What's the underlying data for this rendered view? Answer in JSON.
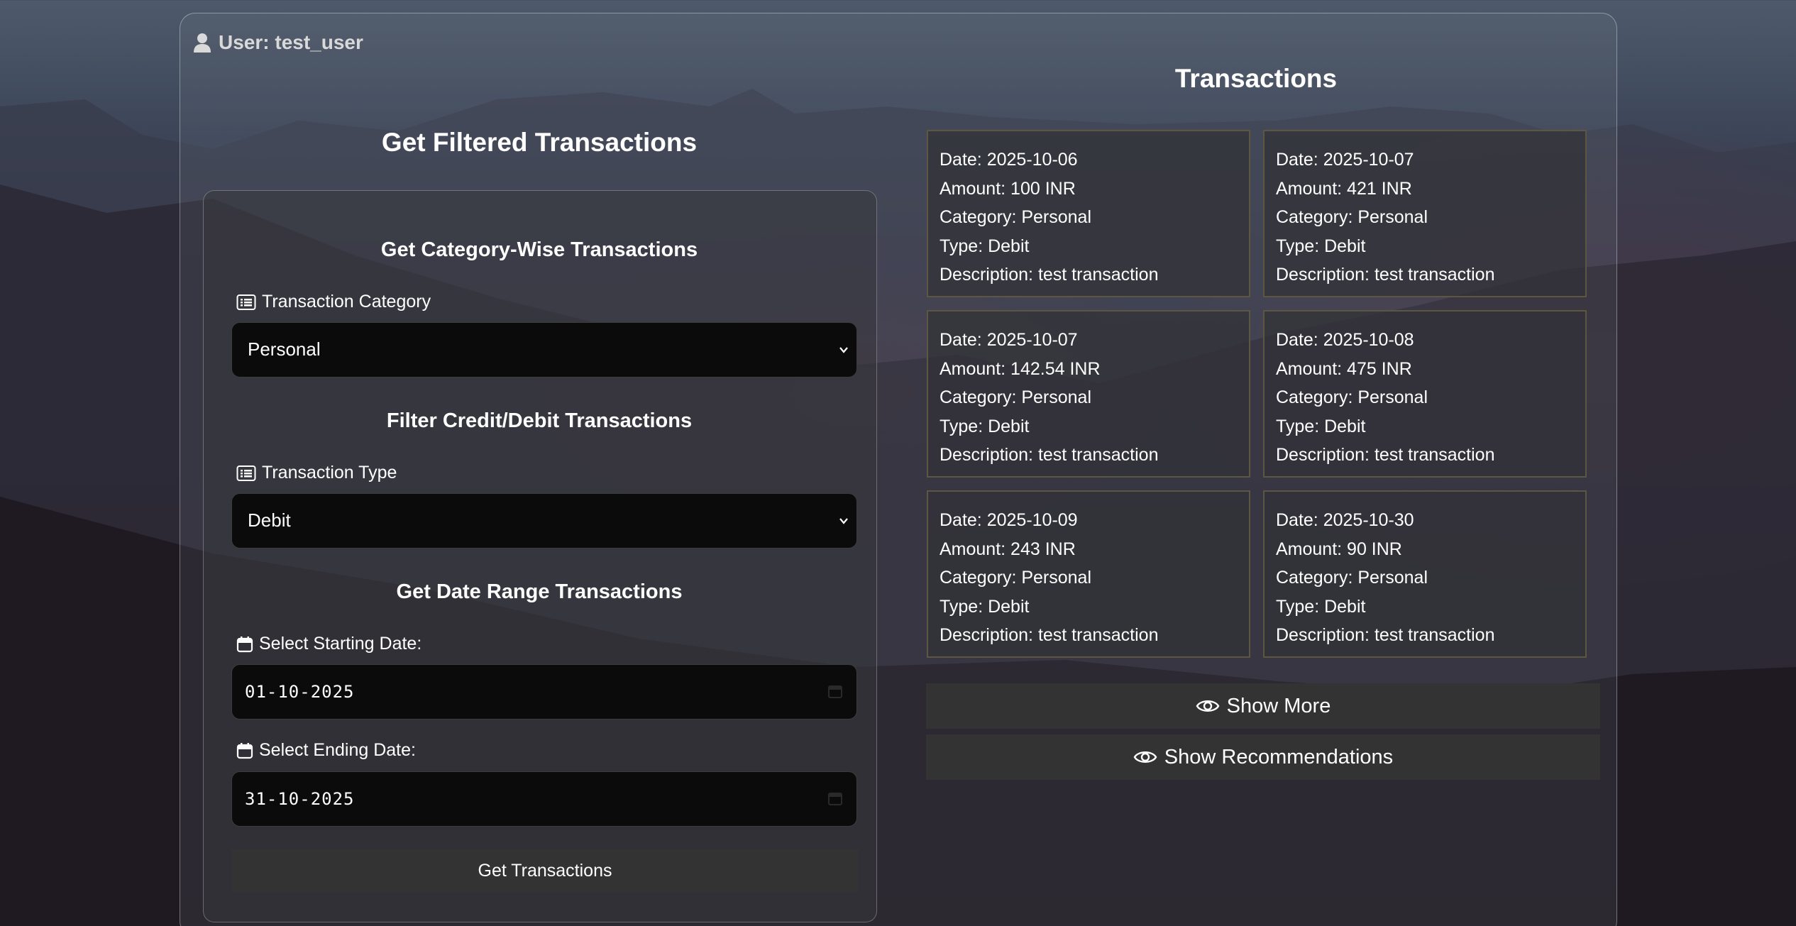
{
  "user": {
    "label": "User: test_user"
  },
  "filters": {
    "title": "Get Filtered Transactions",
    "category_section": {
      "heading": "Get Category-Wise Transactions",
      "label": "Transaction Category",
      "selected": "Personal"
    },
    "type_section": {
      "heading": "Filter Credit/Debit Transactions",
      "label": "Transaction Type",
      "selected": "Debit"
    },
    "date_section": {
      "heading": "Get Date Range Transactions",
      "start_label": "Select Starting Date:",
      "start_value": "01-10-2025",
      "end_label": "Select Ending Date:",
      "end_value": "31-10-2025"
    },
    "submit_label": "Get Transactions"
  },
  "transactions": {
    "title": "Transactions",
    "items": [
      {
        "date": "Date: 2025-10-06",
        "amount": "Amount: 100 INR",
        "category": "Category: Personal",
        "type": "Type: Debit",
        "description": "Description: test transaction"
      },
      {
        "date": "Date: 2025-10-07",
        "amount": "Amount: 421 INR",
        "category": "Category: Personal",
        "type": "Type: Debit",
        "description": "Description: test transaction"
      },
      {
        "date": "Date: 2025-10-07",
        "amount": "Amount: 142.54 INR",
        "category": "Category: Personal",
        "type": "Type: Debit",
        "description": "Description: test transaction"
      },
      {
        "date": "Date: 2025-10-08",
        "amount": "Amount: 475 INR",
        "category": "Category: Personal",
        "type": "Type: Debit",
        "description": "Description: test transaction"
      },
      {
        "date": "Date: 2025-10-09",
        "amount": "Amount: 243 INR",
        "category": "Category: Personal",
        "type": "Type: Debit",
        "description": "Description: test transaction"
      },
      {
        "date": "Date: 2025-10-30",
        "amount": "Amount: 90 INR",
        "category": "Category: Personal",
        "type": "Type: Debit",
        "description": "Description: test transaction"
      }
    ],
    "show_more_label": "Show More",
    "show_recommendations_label": "Show Recommendations"
  },
  "icons": {
    "user": "user-icon",
    "list": "list-icon",
    "calendar": "calendar-icon",
    "eye": "eye-icon",
    "chevron": "chevron-down-icon"
  },
  "colors": {
    "card_border": "#5d5640",
    "button_bg": "#333333",
    "input_bg": "#0b0b0b"
  }
}
